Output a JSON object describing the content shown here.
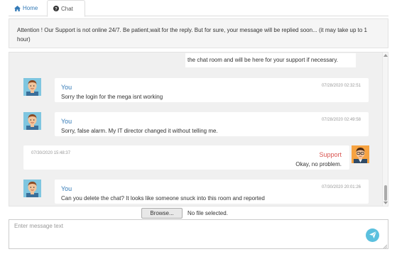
{
  "tabs": {
    "home_label": "Home",
    "chat_label": "Chat"
  },
  "notice": {
    "text": "Attention ! Our Support is not online 24/7. Be patient,wait for the reply. But for sure, your message will be replied soon... (it may take up to 1 hour)"
  },
  "chat": {
    "partial_text": "the chat room and will be here for your support if necessary.",
    "messages": [
      {
        "author": "You",
        "time": "07/28/2020 02:32:51",
        "text": "Sorry the login for the mega isnt working",
        "role": "user"
      },
      {
        "author": "You",
        "time": "07/28/2020 02:49:58",
        "text": "Sorry, false alarm. My IT director changed it without telling me.",
        "role": "user"
      },
      {
        "author": "Support",
        "time": "07/30/2020 15:48:37",
        "text": "Okay, no problem.",
        "role": "support"
      },
      {
        "author": "You",
        "time": "07/30/2020 20:01:26",
        "text": "Can you delete the chat? It looks like someone snuck into this room and reported",
        "role": "user"
      }
    ]
  },
  "file": {
    "browse_label": "Browse...",
    "status": "No file selected."
  },
  "composer": {
    "placeholder": "Enter message text"
  },
  "icons": {
    "home": "home-icon",
    "chat": "question-circle-icon",
    "send": "paper-plane-icon",
    "avatar_user": "user-avatar-icon",
    "avatar_support": "support-avatar-icon"
  },
  "colors": {
    "link": "#337ab7",
    "support_name": "#d9534f",
    "send_button": "#5bc0de"
  }
}
